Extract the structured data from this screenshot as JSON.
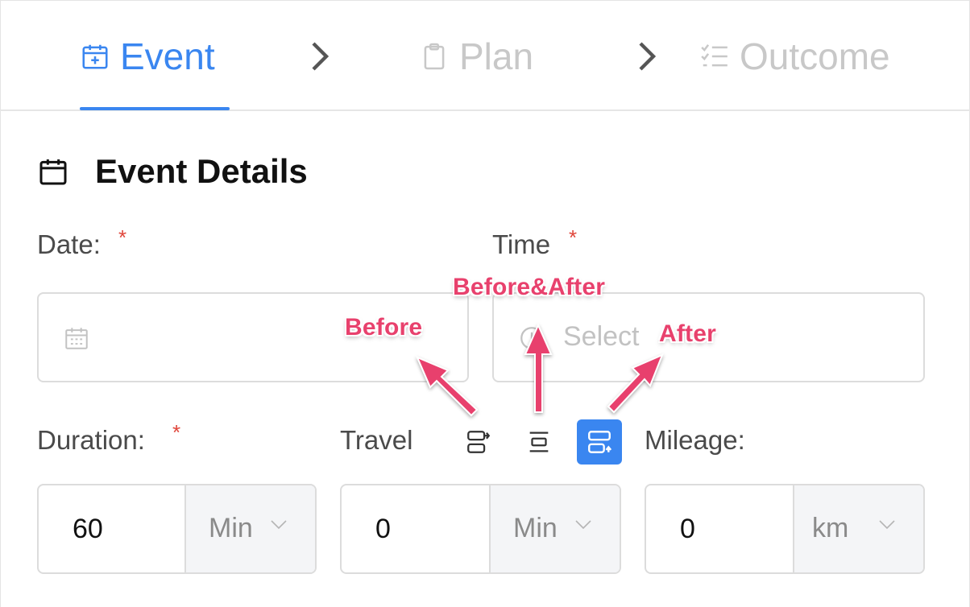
{
  "steps": [
    {
      "label": "Event",
      "icon": "calendar-plus-icon",
      "active": true
    },
    {
      "label": "Plan",
      "icon": "clipboard-icon",
      "active": false
    },
    {
      "label": "Outcome",
      "icon": "checklist-icon",
      "active": false
    }
  ],
  "section": {
    "title": "Event Details",
    "icon": "calendar-icon"
  },
  "fields": {
    "date": {
      "label": "Date:",
      "required": "*",
      "value": "",
      "icon": "calendar-icon"
    },
    "time": {
      "label": "Time",
      "required": "*",
      "placeholder": "Select",
      "icon": "clock-icon"
    },
    "duration": {
      "label": "Duration:",
      "required": "*",
      "value": "60",
      "unit": "Min"
    },
    "travel": {
      "label": "Travel",
      "value": "0",
      "unit": "Min",
      "options": [
        "before",
        "before-and-after",
        "after"
      ],
      "selected": "after"
    },
    "mileage": {
      "label": "Mileage:",
      "value": "0",
      "unit": "km"
    }
  },
  "annotations": {
    "before": "Before",
    "before_after": "Before&After",
    "after": "After"
  },
  "colors": {
    "accent": "#3a86f0",
    "required": "#e0463b",
    "annotation": "#e8416d",
    "inactive": "#c8c8c8"
  }
}
